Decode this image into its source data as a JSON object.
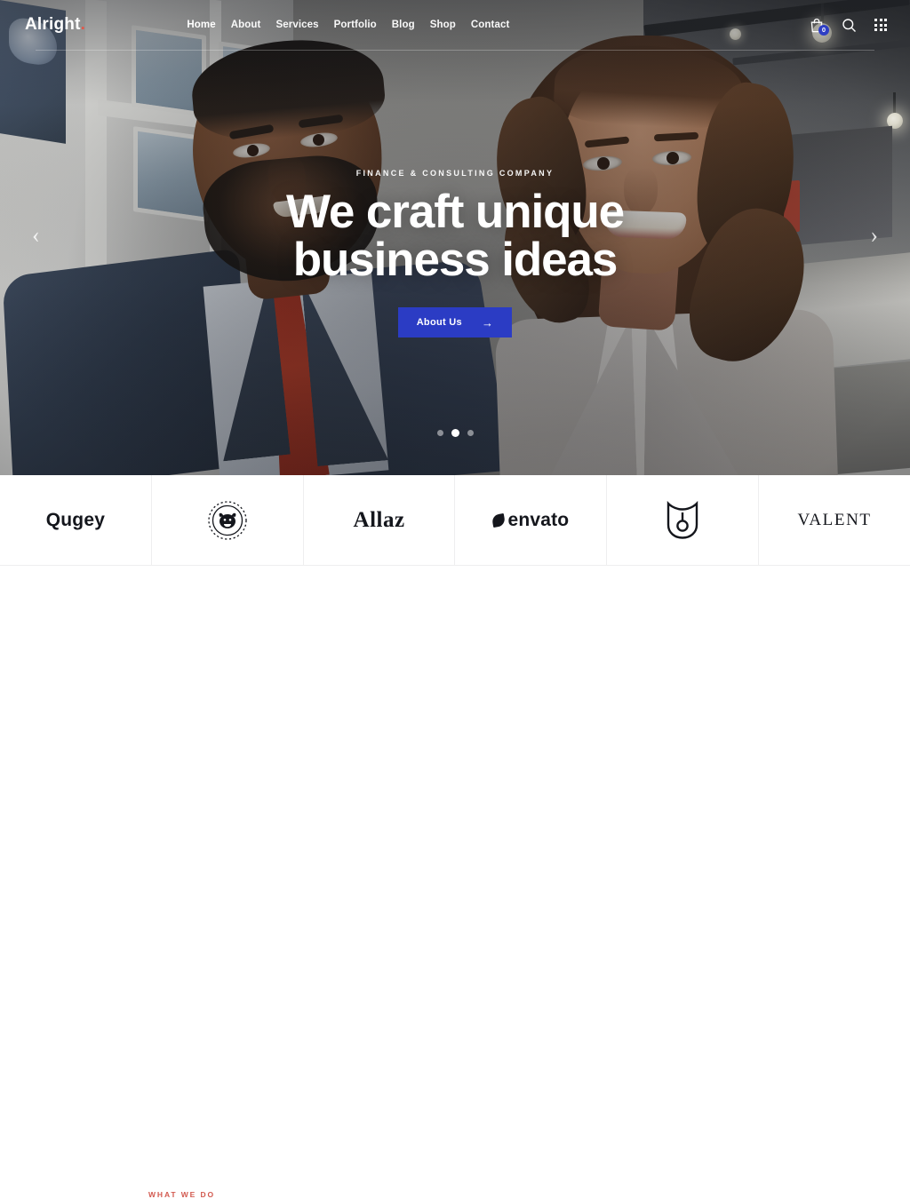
{
  "site": {
    "logo_text": "Alright",
    "logo_dot": "."
  },
  "nav": {
    "items": [
      {
        "label": "Home",
        "active": true
      },
      {
        "label": "About",
        "active": false
      },
      {
        "label": "Services",
        "active": false
      },
      {
        "label": "Portfolio",
        "active": false
      },
      {
        "label": "Blog",
        "active": false
      },
      {
        "label": "Shop",
        "active": false
      },
      {
        "label": "Contact",
        "active": false
      }
    ]
  },
  "header_icons": {
    "cart": {
      "icon": "shopping-bag-icon",
      "badge_count": "0"
    },
    "search": {
      "icon": "search-icon"
    },
    "apps": {
      "icon": "grid-menu-icon"
    }
  },
  "hero": {
    "eyebrow": "FINANCE & CONSULTING COMPANY",
    "headline_line1": "We craft unique",
    "headline_line2": "business ideas",
    "cta_label": "About Us",
    "cta_arrow": "→",
    "prev_arrow": "‹",
    "next_arrow": "›",
    "slides_total": 3,
    "active_slide": 2,
    "accent_color": "#2b3cc4",
    "overlay_text_color": "#ffffff"
  },
  "brands": {
    "items": [
      {
        "name": "Qugey",
        "style": "wordmark"
      },
      {
        "name": "",
        "style": "bulldog-badge-mark"
      },
      {
        "name": "Allaz",
        "style": "serif-wordmark"
      },
      {
        "name": "envato",
        "style": "leaf-wordmark"
      },
      {
        "name": "",
        "style": "tulip-shield-mark"
      },
      {
        "name": "VALENT",
        "style": "serif-spaced-wordmark"
      }
    ]
  },
  "what_we_do": {
    "label": "WHAT WE DO",
    "label_color": "#d2594f"
  }
}
